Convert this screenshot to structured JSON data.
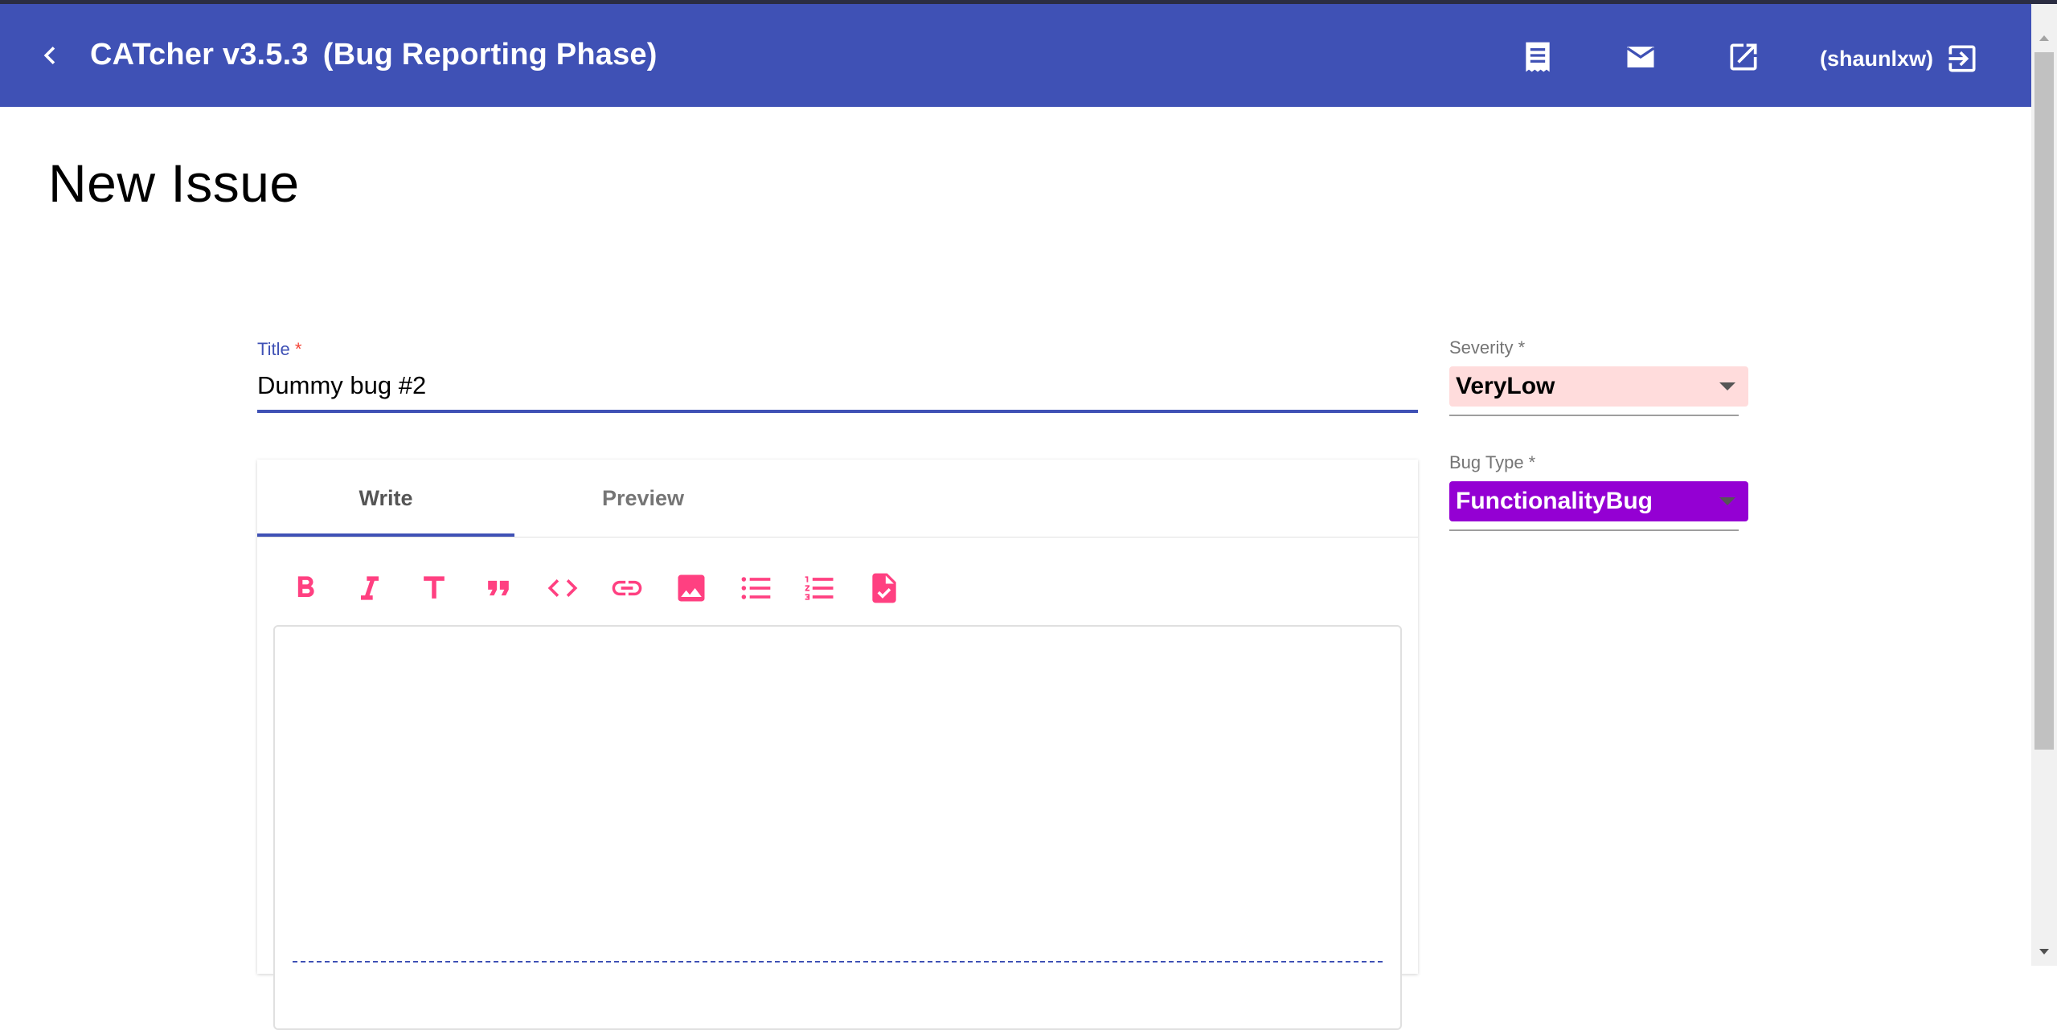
{
  "app": {
    "title": "CATcher v3.5.3",
    "phase": "(Bug Reporting Phase)",
    "user": "(shaunlxw)"
  },
  "page": {
    "title": "New Issue"
  },
  "form": {
    "title_label": "Title",
    "required_mark": "*",
    "title_value": "Dummy bug #2",
    "tabs": [
      "Write",
      "Preview"
    ],
    "active_tab": "Write",
    "toolbar": [
      "bold-icon",
      "italic-icon",
      "heading-icon",
      "quote-icon",
      "code-icon",
      "link-icon",
      "image-icon",
      "bullet-list-icon",
      "numbered-list-icon",
      "task-list-icon"
    ],
    "description_value": ""
  },
  "sidebar": {
    "severity": {
      "label": "Severity *",
      "value": "VeryLow",
      "color": "#ffdcdc"
    },
    "bug_type": {
      "label": "Bug Type *",
      "value": "FunctionalityBug",
      "color": "#9400d3"
    }
  },
  "icons": {
    "header": [
      "back-arrow-icon",
      "receipt-icon",
      "mail-icon",
      "open-in-new-icon",
      "logout-icon"
    ]
  },
  "colors": {
    "primary": "#3f51b5",
    "accent": "#ff4081"
  }
}
